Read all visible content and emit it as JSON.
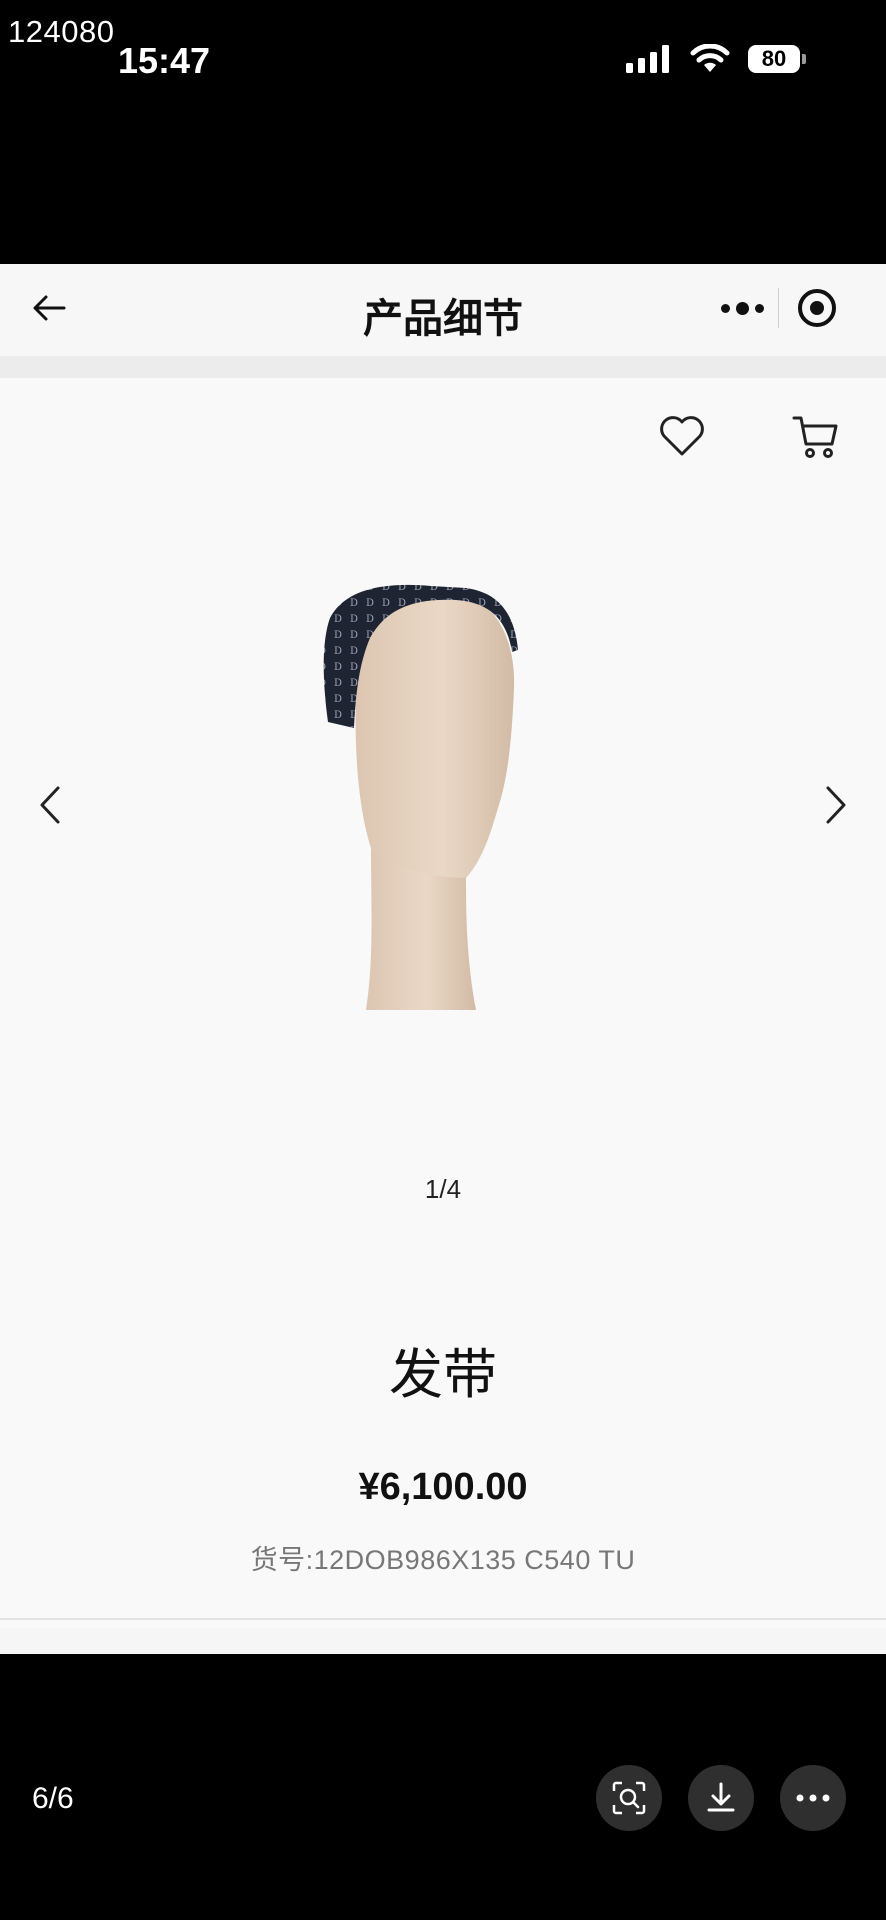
{
  "watermark": "124080",
  "status_bar": {
    "time": "15:47",
    "battery": "80"
  },
  "navbar": {
    "title": "产品细节"
  },
  "product": {
    "pager": "1/4",
    "name": "发带",
    "price": "¥6,100.00",
    "sku": "货号:12DOB986X135 C540 TU"
  },
  "viewer": {
    "counter": "6/6"
  },
  "icons": {
    "back": "back-arrow-icon",
    "more": "more-dots-icon",
    "close": "target-circle-icon",
    "favorite": "heart-icon",
    "cart": "cart-icon",
    "prev": "chevron-left-icon",
    "next": "chevron-right-icon",
    "scan": "scan-search-icon",
    "download": "download-icon",
    "viewer_more": "ellipsis-icon"
  },
  "colors": {
    "background": "#000000",
    "page": "#f9f9f9",
    "sku_text": "#777777"
  }
}
